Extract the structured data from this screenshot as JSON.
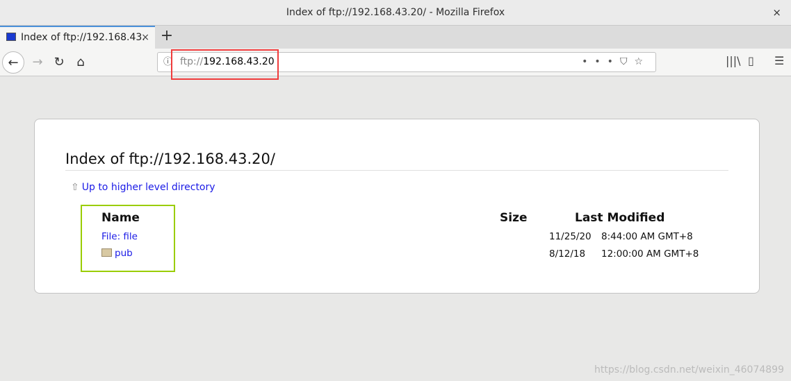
{
  "window": {
    "title": "Index of ftp://192.168.43.20/ - Mozilla Firefox",
    "close": "×"
  },
  "tab": {
    "label": "Index of ftp://192.168.43.",
    "close": "×",
    "new": "+"
  },
  "nav": {
    "back": "←",
    "forward": "→",
    "reload": "↻",
    "home": "⌂",
    "url_prefix": "ftp://",
    "url_host": "192.168.43.20",
    "info": "ⓘ",
    "more": "•••",
    "pocket": "⛉",
    "star": "☆",
    "library": "|||\\",
    "sidebar": "▯",
    "menu": "☰"
  },
  "page": {
    "title": "Index of ftp://192.168.43.20/",
    "up_link": "Up to higher level directory",
    "headers": {
      "name": "Name",
      "size": "Size",
      "modified": "Last Modified"
    },
    "rows": [
      {
        "name": "File: file",
        "size": "",
        "date": "11/25/20",
        "time": "8:44:00 AM GMT+8"
      },
      {
        "name": "pub",
        "size": "",
        "date": "8/12/18",
        "time": "12:00:00 AM GMT+8"
      }
    ]
  },
  "watermark": "https://blog.csdn.net/weixin_46074899"
}
